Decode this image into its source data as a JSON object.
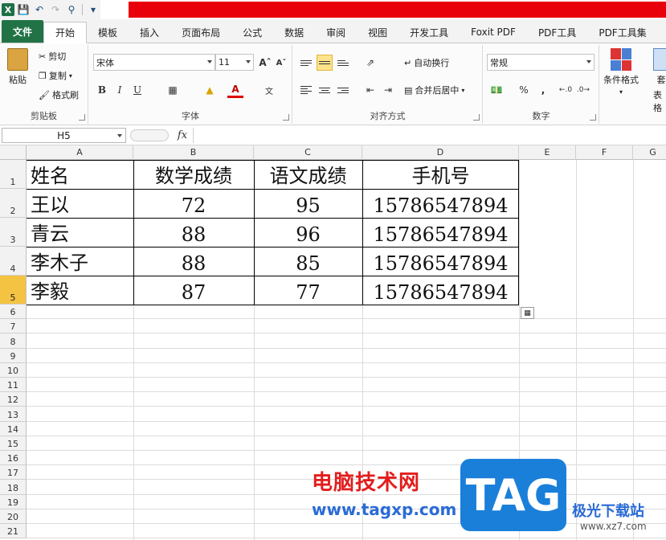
{
  "quick_access": {
    "icons": [
      "excel-icon",
      "save-icon",
      "undo-icon",
      "redo-icon",
      "binoculars-icon",
      "customize-icon"
    ]
  },
  "tabs": [
    {
      "label": "文件"
    },
    {
      "label": "开始"
    },
    {
      "label": "模板"
    },
    {
      "label": "插入"
    },
    {
      "label": "页面布局"
    },
    {
      "label": "公式"
    },
    {
      "label": "数据"
    },
    {
      "label": "审阅"
    },
    {
      "label": "视图"
    },
    {
      "label": "开发工具"
    },
    {
      "label": "Foxit PDF"
    },
    {
      "label": "PDF工具"
    },
    {
      "label": "PDF工具集"
    }
  ],
  "ribbon": {
    "clipboard": {
      "paste": "粘贴",
      "cut": "剪切",
      "copy": "复制",
      "format_painter": "格式刷",
      "label": "剪贴板"
    },
    "font": {
      "family": "宋体",
      "size": "11",
      "bold": "B",
      "italic": "I",
      "underline": "U",
      "color_letter": "A",
      "label": "字体"
    },
    "alignment": {
      "wrap_text": "自动换行",
      "merge_center": "合并后居中",
      "label": "对齐方式"
    },
    "number": {
      "format": "常规",
      "percent": "%",
      "comma": ",",
      "label": "数字"
    },
    "styles": {
      "conditional": "条件格式",
      "table_partial": "套",
      "table2_partial": "表格"
    }
  },
  "formula_bar": {
    "name_box": "H5",
    "fx": "fx",
    "value": ""
  },
  "columns": [
    "A",
    "B",
    "C",
    "D",
    "E",
    "F",
    "G"
  ],
  "rows": [
    "1",
    "2",
    "3",
    "4",
    "5",
    "6",
    "7",
    "8",
    "9",
    "10",
    "11",
    "12",
    "13",
    "14",
    "15",
    "16",
    "17",
    "18",
    "19",
    "20",
    "21"
  ],
  "table": {
    "headers": [
      "姓名",
      "数学成绩",
      "语文成绩",
      "手机号"
    ],
    "rows": [
      [
        "王以",
        "72",
        "95",
        "15786547894"
      ],
      [
        "青云",
        "88",
        "96",
        "15786547894"
      ],
      [
        "李木子",
        "88",
        "85",
        "15786547894"
      ],
      [
        "李毅",
        "87",
        "77",
        "15786547894"
      ]
    ]
  },
  "watermark": {
    "site_name": "电脑技术网",
    "site_url": "www.tagxp.com",
    "tag": "TAG",
    "brand": "极光下载站",
    "brand_url": "www.xz7.com"
  },
  "colors": {
    "file_tab": "#217346",
    "title_red": "#e8000b",
    "active_row": "#f5c342",
    "watermark_blue": "#1a7fd9",
    "watermark_red": "#e21d1d"
  }
}
